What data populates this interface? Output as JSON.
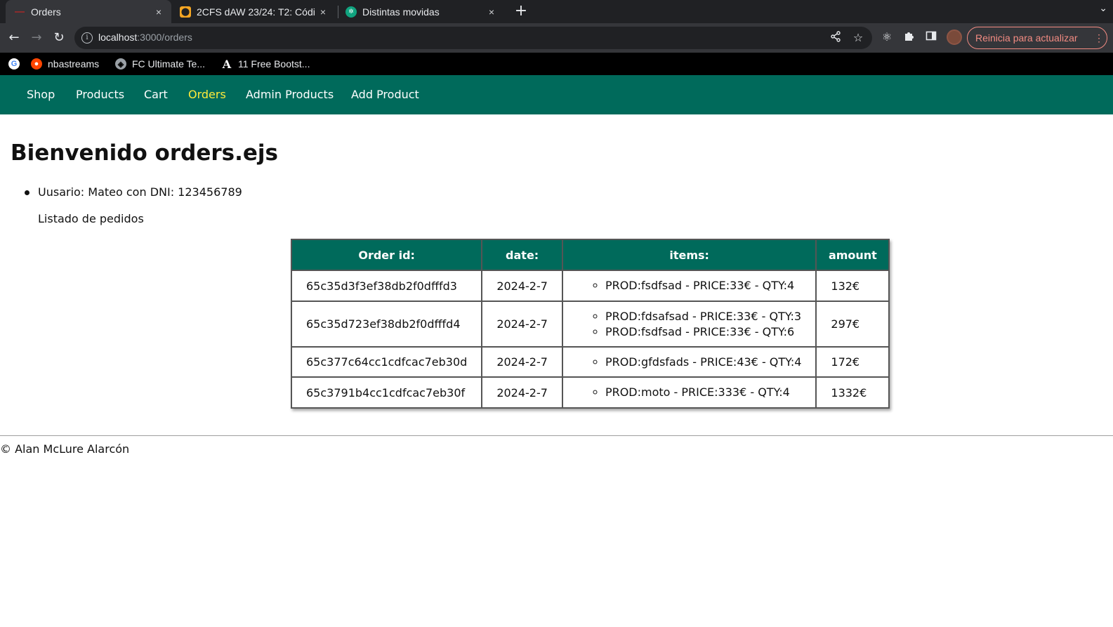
{
  "browser": {
    "tabs": [
      {
        "title": "Orders",
        "active": true,
        "close": "×"
      },
      {
        "title": "2CFS dAW 23/24: T2: Códi",
        "active": false,
        "close": "×"
      },
      {
        "title": "Distintas movidas",
        "active": false,
        "close": "×"
      }
    ],
    "new_tab": "+",
    "address": {
      "host": "localhost",
      "path": ":3000/orders"
    },
    "update_button": "Reinicia para actualizar",
    "bookmarks": [
      {
        "label": "",
        "icon": "google-icon"
      },
      {
        "label": "nbastreams",
        "icon": "reddit-icon"
      },
      {
        "label": "FC Ultimate Te...",
        "icon": "globe-icon"
      },
      {
        "label": "11 Free Bootst...",
        "icon": "a-logo-icon"
      }
    ]
  },
  "nav": {
    "items": [
      "Shop",
      "Products",
      "Cart",
      "Orders",
      "Admin Products",
      "Add Product"
    ],
    "active": "Orders",
    "color": "#006a5b",
    "active_color": "#ffeb3b"
  },
  "page": {
    "title": "Bienvenido orders.ejs",
    "user_line": "Uusario: Mateo con DNI: 123456789",
    "orders_caption": "Listado de pedidos"
  },
  "orders_table": {
    "headers": {
      "id": "Order id:",
      "date": "date:",
      "items": "items:",
      "amount": "amount"
    },
    "rows": [
      {
        "id": "65c35d3f3ef38db2f0dfffd3",
        "date": "2024-2-7",
        "items": [
          "PROD:fsdfsad - PRICE:33€ - QTY:4"
        ],
        "amount": "132€"
      },
      {
        "id": "65c35d723ef38db2f0dfffd4",
        "date": "2024-2-7",
        "items": [
          "PROD:fdsafsad - PRICE:33€ - QTY:3",
          "PROD:fsdfsad - PRICE:33€ - QTY:6"
        ],
        "amount": "297€"
      },
      {
        "id": "65c377c64cc1cdfcac7eb30d",
        "date": "2024-2-7",
        "items": [
          "PROD:gfdsfads - PRICE:43€ - QTY:4"
        ],
        "amount": "172€"
      },
      {
        "id": "65c3791b4cc1cdfcac7eb30f",
        "date": "2024-2-7",
        "items": [
          "PROD:moto - PRICE:333€ - QTY:4"
        ],
        "amount": "1332€"
      }
    ]
  },
  "footer": {
    "text": "© Alan McLure Alarcón"
  }
}
